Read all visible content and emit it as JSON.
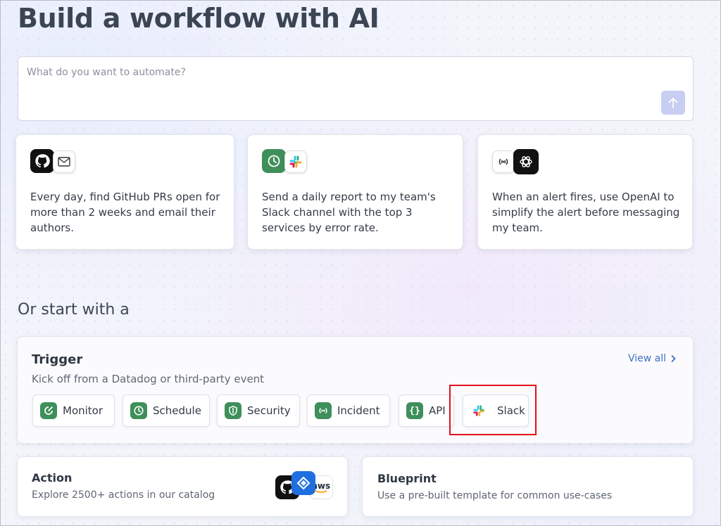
{
  "page": {
    "title": "Build a workflow with AI",
    "prompt_placeholder": "What do you want to automate?"
  },
  "suggestions": [
    {
      "text": "Every day, find GitHub PRs open for more than 2 weeks and email their authors.",
      "icons": [
        "github-icon",
        "mail-icon"
      ]
    },
    {
      "text": "Send a daily report to my team's Slack channel with the top 3 services by error rate.",
      "icons": [
        "schedule-icon",
        "slack-icon"
      ]
    },
    {
      "text": "When an alert fires, use OpenAI to simplify the alert before messaging my team.",
      "icons": [
        "incident-icon",
        "openai-icon"
      ]
    }
  ],
  "start_section": {
    "heading": "Or start with a",
    "trigger": {
      "title": "Trigger",
      "description": "Kick off from a Datadog or third-party event",
      "view_all": "View all",
      "chips": [
        {
          "label": "Monitor",
          "icon": "monitor-icon"
        },
        {
          "label": "Schedule",
          "icon": "clock-icon"
        },
        {
          "label": "Security",
          "icon": "shield-icon"
        },
        {
          "label": "Incident",
          "icon": "incident-icon"
        },
        {
          "label": "API",
          "icon": "braces-icon"
        },
        {
          "label": "Slack",
          "icon": "slack-icon"
        }
      ]
    },
    "action": {
      "title": "Action",
      "description": "Explore 2500+ actions in our catalog",
      "logos": [
        "github-icon",
        "jira-icon",
        "aws-icon"
      ],
      "aws_text": "aws"
    },
    "blueprint": {
      "title": "Blueprint",
      "description": "Use a pre-built template for common use-cases"
    }
  },
  "colors": {
    "accent": "#3f6fc4",
    "datadog_green": "#3e8f5a",
    "highlight_red": "#e3101b"
  }
}
